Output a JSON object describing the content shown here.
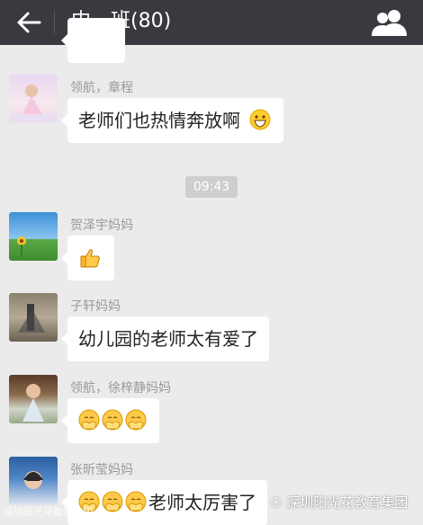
{
  "header": {
    "title": "中一班(80)",
    "back_icon": "back-arrow-icon",
    "group_icon": "group-members-icon"
  },
  "messages": [
    {
      "sender": "领航，章程",
      "text": "老师们也热情奔放啊",
      "emoji": "grin-emoji"
    },
    {
      "sender": "贺泽宇妈妈",
      "text": "",
      "emoji": "thumbs-up-emoji"
    },
    {
      "sender": "子轩妈妈",
      "text": "幼儿园的老师太有爱了"
    },
    {
      "sender": "领航，徐梓静妈妈",
      "text": "",
      "emoji": "clapping-emoji x3"
    },
    {
      "sender": "张昕莹妈妈",
      "text": "老师太厉害了",
      "emoji": "clapping-emoji x3"
    }
  ],
  "timestamp": "09:43",
  "watermark": "深圳阳光花教育集团",
  "watermark_small": "深圳阳光花教育集团"
}
